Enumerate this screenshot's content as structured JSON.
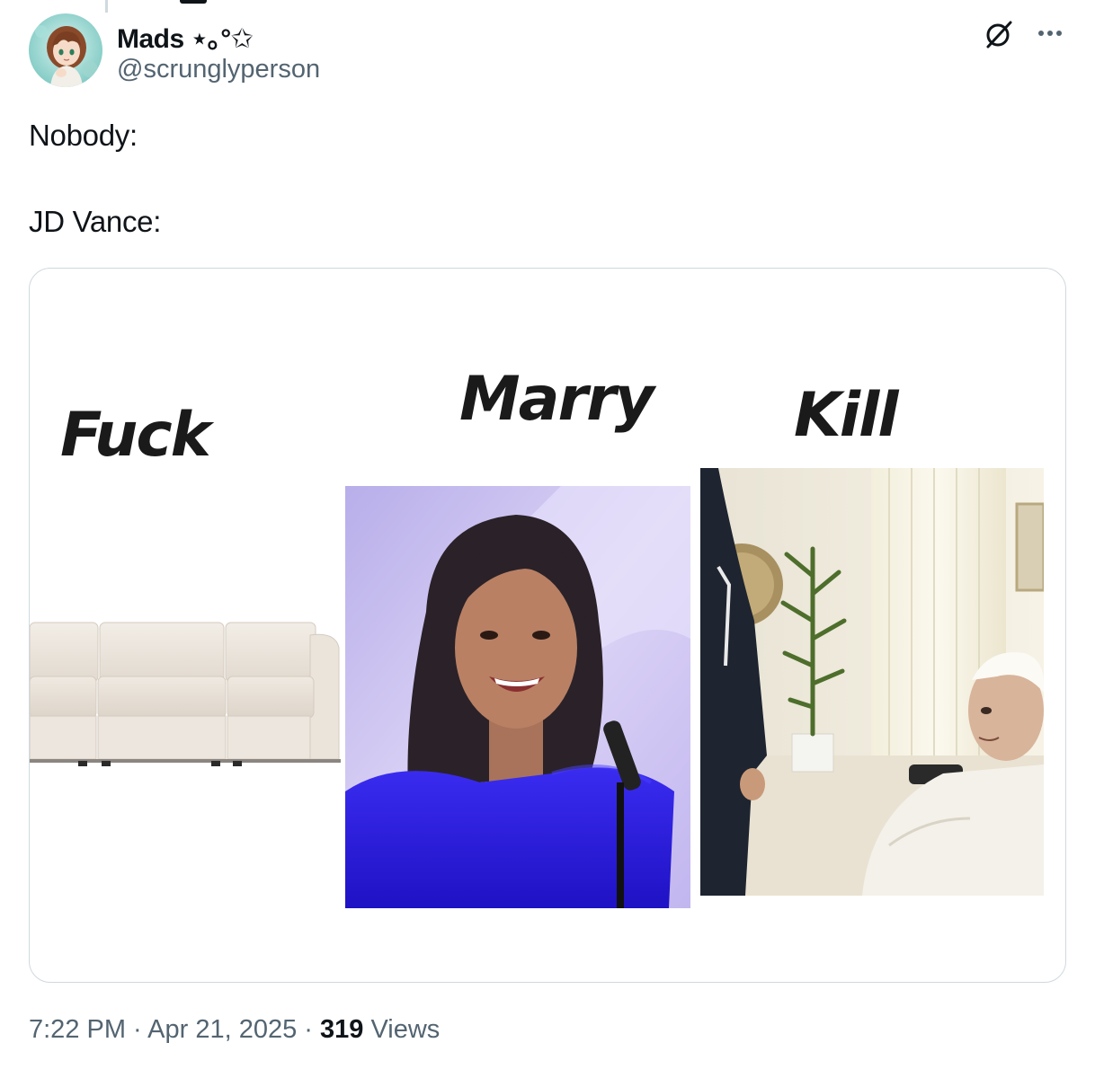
{
  "author": {
    "display_name": "Mads ⋆｡°✩",
    "handle": "@scrunglyperson",
    "avatar_icon": "anime-avatar"
  },
  "actions": {
    "grok_icon": "grok-icon",
    "more_icon": "more-icon"
  },
  "tweet": {
    "line1": "Nobody:",
    "line2": "JD Vance:"
  },
  "media": {
    "labels": {
      "first": "Fuck",
      "second": "Marry",
      "third": "Kill"
    }
  },
  "meta": {
    "time": "7:22 PM",
    "separator1": " · ",
    "date": "Apr 21, 2025",
    "separator2": " · ",
    "views_count": "319",
    "views_label": " Views"
  },
  "colors": {
    "text_primary": "#0f1419",
    "text_secondary": "#536471",
    "border": "#cfd9de",
    "dress_blue": "#2a1ee0",
    "stage_lilac": "#cabff0"
  }
}
